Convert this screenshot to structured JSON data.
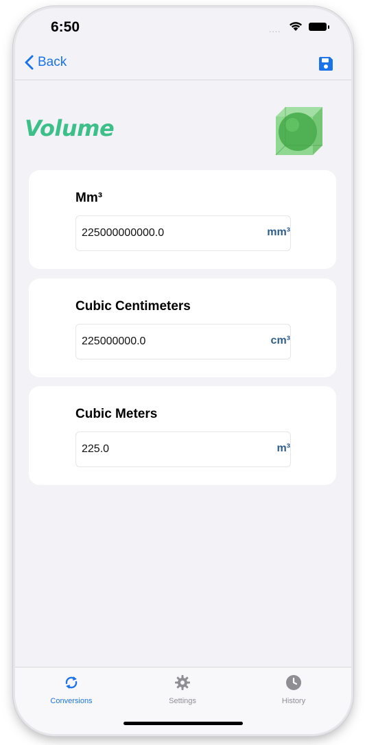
{
  "status_bar": {
    "time": "6:50",
    "signal": "....",
    "wifi_icon": "wifi-icon",
    "battery_icon": "battery-icon"
  },
  "nav": {
    "back_label": "Back",
    "back_icon": "chevron-left-icon",
    "save_icon": "floppy-disk-icon",
    "accent_color": "#1a73e8"
  },
  "header": {
    "title": "Volume",
    "title_color": "#3dbf89",
    "icon": "cube-sphere-icon"
  },
  "conversions": [
    {
      "label": "Mm³",
      "value": "225000000000.0",
      "unit": "mm³"
    },
    {
      "label": "Cubic Centimeters",
      "value": "225000000.0",
      "unit": "cm³"
    },
    {
      "label": "Cubic Meters",
      "value": "225.0",
      "unit": "m³"
    }
  ],
  "tab_bar": {
    "tabs": [
      {
        "label": "Conversions",
        "icon": "refresh-arrows-icon",
        "active": true
      },
      {
        "label": "Settings",
        "icon": "gear-icon",
        "active": false
      },
      {
        "label": "History",
        "icon": "clock-icon",
        "active": false
      }
    ]
  }
}
